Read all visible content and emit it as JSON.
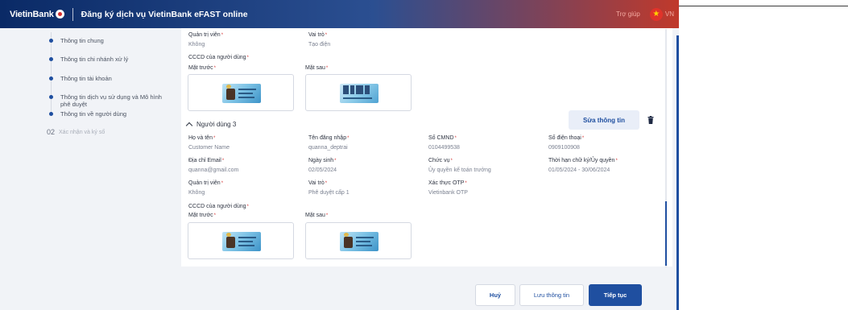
{
  "header": {
    "logo_text": "VietinBank",
    "title": "Đăng ký dịch vụ VietinBank eFAST online",
    "help_link": "Trợ giúp",
    "language": "VN"
  },
  "sidebar": {
    "items": [
      {
        "label": "Thông tin chung"
      },
      {
        "label": "Thông tin chi nhánh xử lý"
      },
      {
        "label": "Thông tin tài khoản"
      },
      {
        "label": "Thông tin dịch vụ sử dụng và Mô hình phê duyệt"
      },
      {
        "label": "Thông tin về người dùng"
      }
    ],
    "step2": {
      "number": "02",
      "label": "Xác nhận và ký số"
    }
  },
  "user2": {
    "admin_label": "Quản trị viên",
    "admin_value": "Không",
    "role_label": "Vai trò",
    "role_value": "Tạo điện",
    "id_label": "CCCD của người dùng",
    "front_label": "Mặt trước",
    "back_label": "Mặt sau"
  },
  "user3": {
    "title": "Người dùng 3",
    "edit_button": "Sửa thông tin",
    "fields": {
      "name_label": "Họ và tên",
      "name_value": "Customer Name",
      "username_label": "Tên đăng nhập",
      "username_value": "quanna_deptrai",
      "cmnd_label": "Số CMND",
      "cmnd_value": "0104499538",
      "phone_label": "Số điện thoại",
      "phone_value": "0909100908",
      "email_label": "Địa chỉ Email",
      "email_value": "quanna@gmail.com",
      "dob_label": "Ngày sinh",
      "dob_value": "02/05/2024",
      "position_label": "Chức vụ",
      "position_value": "Ủy quyền kế toán trưởng",
      "term_label": "Thời hạn chữ ký/Ủy quyền",
      "term_value": "01/05/2024 - 30/06/2024",
      "admin_label": "Quản trị viên",
      "admin_value": "Không",
      "role_label": "Vai trò",
      "role_value": "Phê duyệt cấp 1",
      "otp_label": "Xác thực OTP",
      "otp_value": "Vietinbank OTP",
      "id_label": "CCCD của người dùng",
      "front_label": "Mặt trước",
      "back_label": "Mặt sau"
    }
  },
  "footer": {
    "cancel": "Huỷ",
    "save": "Lưu thông tin",
    "next": "Tiếp tục"
  },
  "colors": {
    "primary": "#1f4fa0",
    "header_start": "#0a2a66",
    "header_end": "#c0392b",
    "required": "#d63a3a"
  }
}
